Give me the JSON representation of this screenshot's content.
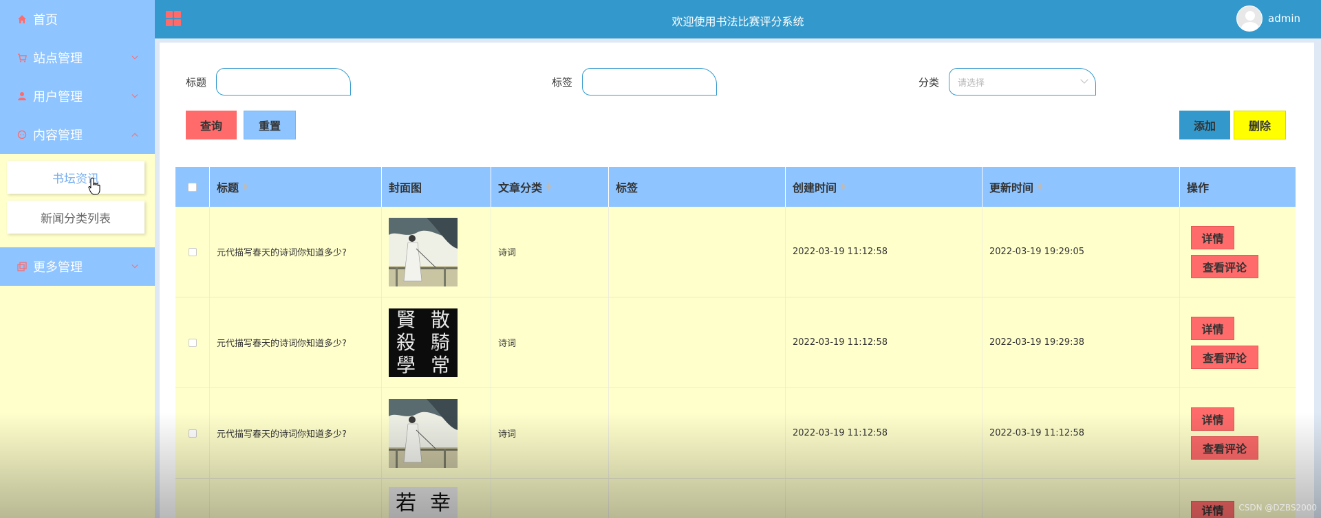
{
  "sidebar": {
    "items": [
      {
        "label": "首页",
        "icon": "home-icon"
      },
      {
        "label": "站点管理",
        "icon": "cart-icon"
      },
      {
        "label": "用户管理",
        "icon": "user-icon"
      },
      {
        "label": "内容管理",
        "icon": "chat-icon"
      },
      {
        "label": "更多管理",
        "icon": "copy-icon"
      }
    ],
    "submenu": [
      "书坛资讯",
      "新闻分类列表"
    ]
  },
  "header": {
    "title": "欢迎使用书法比赛评分系统",
    "username": "admin"
  },
  "search": {
    "title_label": "标题",
    "tag_label": "标签",
    "category_label": "分类",
    "category_placeholder": "请选择",
    "query_button": "查询",
    "reset_button": "重置",
    "add_button": "添加",
    "delete_button": "删除"
  },
  "table": {
    "headers": [
      "标题",
      "封面图",
      "文章分类",
      "标签",
      "创建时间",
      "更新时间",
      "操作"
    ],
    "rows": [
      {
        "title": "元代描写春天的诗词你知道多少?",
        "category": "诗词",
        "tag": "",
        "created": "2022-03-19 11:12:58",
        "updated": "2022-03-19 19:29:05"
      },
      {
        "title": "元代描写春天的诗词你知道多少?",
        "category": "诗词",
        "tag": "",
        "created": "2022-03-19 11:12:58",
        "updated": "2022-03-19 19:29:38"
      },
      {
        "title": "元代描写春天的诗词你知道多少?",
        "category": "诗词",
        "tag": "",
        "created": "2022-03-19 11:12:58",
        "updated": "2022-03-19 11:12:58"
      }
    ],
    "detail_button": "详情",
    "comment_button": "查看评论",
    "thumb2_chars": [
      "賢",
      "散",
      "殺",
      "騎",
      "學",
      "常"
    ],
    "thumb4_chars": [
      "若",
      "幸"
    ]
  },
  "colors": {
    "menu_bg": "#8ec4ff",
    "header_bg": "#3399cc",
    "page_bg": "#ffffcc",
    "danger": "#ff6b6b",
    "yellow": "#ffff00"
  },
  "watermark": "CSDN @DZBS2000"
}
